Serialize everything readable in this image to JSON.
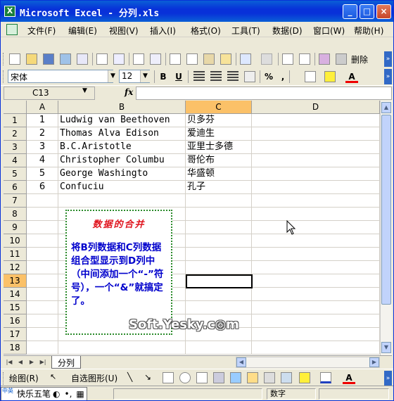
{
  "window": {
    "title": "Microsoft Excel - 分列.xls",
    "icon": "excel-icon"
  },
  "title_buttons": [
    "_",
    "□",
    "×"
  ],
  "menu": {
    "items": [
      "文件(F)",
      "编辑(E)",
      "视图(V)",
      "插入(I)",
      "格式(O)",
      "工具(T)",
      "数据(D)",
      "窗口(W)",
      "帮助(H)"
    ],
    "right": "- ♂ ×"
  },
  "standard_toolbar": {
    "delete_label": "删除"
  },
  "format_toolbar": {
    "font": "宋体",
    "size": "12",
    "bold": "B",
    "underline": "U",
    "percent": "%",
    "comma": ","
  },
  "formula_bar": {
    "name_box": "C13",
    "fx": "fx",
    "formula": ""
  },
  "grid": {
    "columns": [
      "A",
      "B",
      "C",
      "D"
    ],
    "active_column": "C",
    "rows": [
      "1",
      "2",
      "3",
      "4",
      "5",
      "6",
      "7",
      "8",
      "9",
      "10",
      "11",
      "12",
      "13",
      "14",
      "15",
      "16",
      "17",
      "18"
    ],
    "active_row": "13",
    "data": [
      {
        "a": "1",
        "b": "Ludwig van Beethoven",
        "c": "贝多芬"
      },
      {
        "a": "2",
        "b": "Thomas Alva Edison",
        "c": "爱迪生"
      },
      {
        "a": "3",
        "b": "B.C.Aristotle",
        "c": "亚里士多德"
      },
      {
        "a": "4",
        "b": "Christopher Columbu",
        "c": "哥伦布"
      },
      {
        "a": "5",
        "b": "George Washingto",
        "c": "华盛顿"
      },
      {
        "a": "6",
        "b": "Confuciu",
        "c": "孔子"
      }
    ]
  },
  "note": {
    "title": "数据的合并",
    "body": "将B列数据和C列数据组合型显示到D列中（中间添加一个“-”符号），一个“&”就搞定了。"
  },
  "watermark": "Soft.Yesky.c◎m",
  "sheet_tabs": {
    "active": "分列"
  },
  "draw_toolbar": {
    "draw_label": "绘图(R)",
    "autoshapes_label": "自选图形(U)"
  },
  "status": {
    "ime": "快乐五笔",
    "ime_prefix": "中英",
    "mode": "数字"
  }
}
